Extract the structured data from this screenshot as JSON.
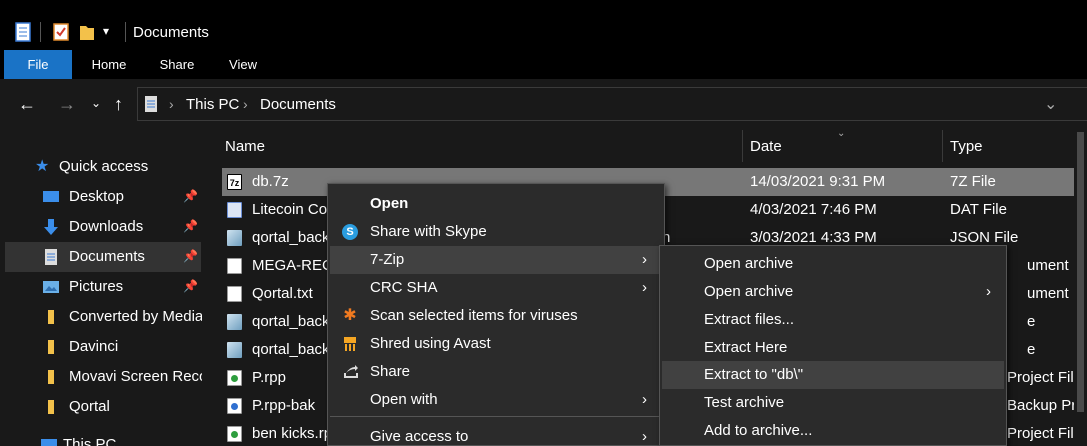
{
  "window": {
    "title": "Documents"
  },
  "ribbon": {
    "tabs": [
      "File",
      "Home",
      "Share",
      "View"
    ]
  },
  "address": {
    "segments": [
      "This PC",
      "Documents"
    ]
  },
  "nav": {
    "items": [
      {
        "label": "Quick access",
        "pinned": false
      },
      {
        "label": "Desktop",
        "pinned": true
      },
      {
        "label": "Downloads",
        "pinned": true
      },
      {
        "label": "Documents",
        "pinned": true,
        "selected": true
      },
      {
        "label": "Pictures",
        "pinned": true
      },
      {
        "label": "Converted by Media",
        "pinned": false
      },
      {
        "label": "Davinci",
        "pinned": false
      },
      {
        "label": "Movavi Screen Reco",
        "pinned": false
      },
      {
        "label": "Qortal",
        "pinned": false
      },
      {
        "label": "This PC",
        "pinned": false
      }
    ]
  },
  "columns": {
    "name": "Name",
    "date": "Date",
    "type": "Type"
  },
  "files": [
    {
      "name": "db.7z",
      "date": "14/03/2021 9:31 PM",
      "type": "7Z File",
      "icon": "7z-icon",
      "selected": true
    },
    {
      "name": "Litecoin Co",
      "date": "4/03/2021 7:46 PM",
      "type": "DAT File",
      "icon": "dat-icon"
    },
    {
      "name": "qortal_back",
      "name_tail": "n",
      "date": "3/03/2021 4:33 PM",
      "type": "JSON File",
      "icon": "json-icon"
    },
    {
      "name": "MEGA-RECO",
      "date": "",
      "type": "ument",
      "icon": "text-icon"
    },
    {
      "name": "Qortal.txt",
      "date": "",
      "type": "ument",
      "icon": "text-icon"
    },
    {
      "name": "qortal_back",
      "date": "",
      "type": "e",
      "icon": "json-icon"
    },
    {
      "name": "qortal_back",
      "date": "",
      "type": "e",
      "icon": "json-icon"
    },
    {
      "name": "P.rpp",
      "date": "",
      "type": "Project File",
      "icon": "rpp-icon"
    },
    {
      "name": "P.rpp-bak",
      "date": "",
      "type": "Backup Pr...",
      "icon": "rpp-bak-icon"
    },
    {
      "name": "ben kicks.rp",
      "date": "",
      "type": "Project File",
      "icon": "rpp-icon"
    }
  ],
  "context_menu": {
    "items": [
      {
        "label": "Open",
        "bold": true,
        "icon": ""
      },
      {
        "label": "Share with Skype",
        "icon": "skype-icon"
      },
      {
        "label": "7-Zip",
        "submenu": true,
        "highlighted": true,
        "icon": ""
      },
      {
        "label": "CRC SHA",
        "submenu": true,
        "icon": ""
      },
      {
        "label": "Scan selected items for viruses",
        "icon": "avast-icon"
      },
      {
        "label": "Shred using Avast",
        "icon": "shred-icon"
      },
      {
        "label": "Share",
        "icon": "share-icon"
      },
      {
        "label": "Open with",
        "submenu": true,
        "icon": ""
      },
      {
        "label": "Give access to",
        "submenu": true,
        "icon": ""
      }
    ]
  },
  "zip_menu": {
    "items": [
      {
        "label": "Open archive"
      },
      {
        "label": "Open archive",
        "submenu": true
      },
      {
        "label": "Extract files..."
      },
      {
        "label": "Extract Here"
      },
      {
        "label": "Extract to \"db\\\"",
        "highlighted": true
      },
      {
        "label": "Test archive"
      },
      {
        "label": "Add to archive..."
      }
    ]
  },
  "colors": {
    "file_tab": "#1a73c6",
    "selection": "#777777",
    "menu_bg": "#2b2b2b",
    "menu_highlight": "#414141"
  }
}
